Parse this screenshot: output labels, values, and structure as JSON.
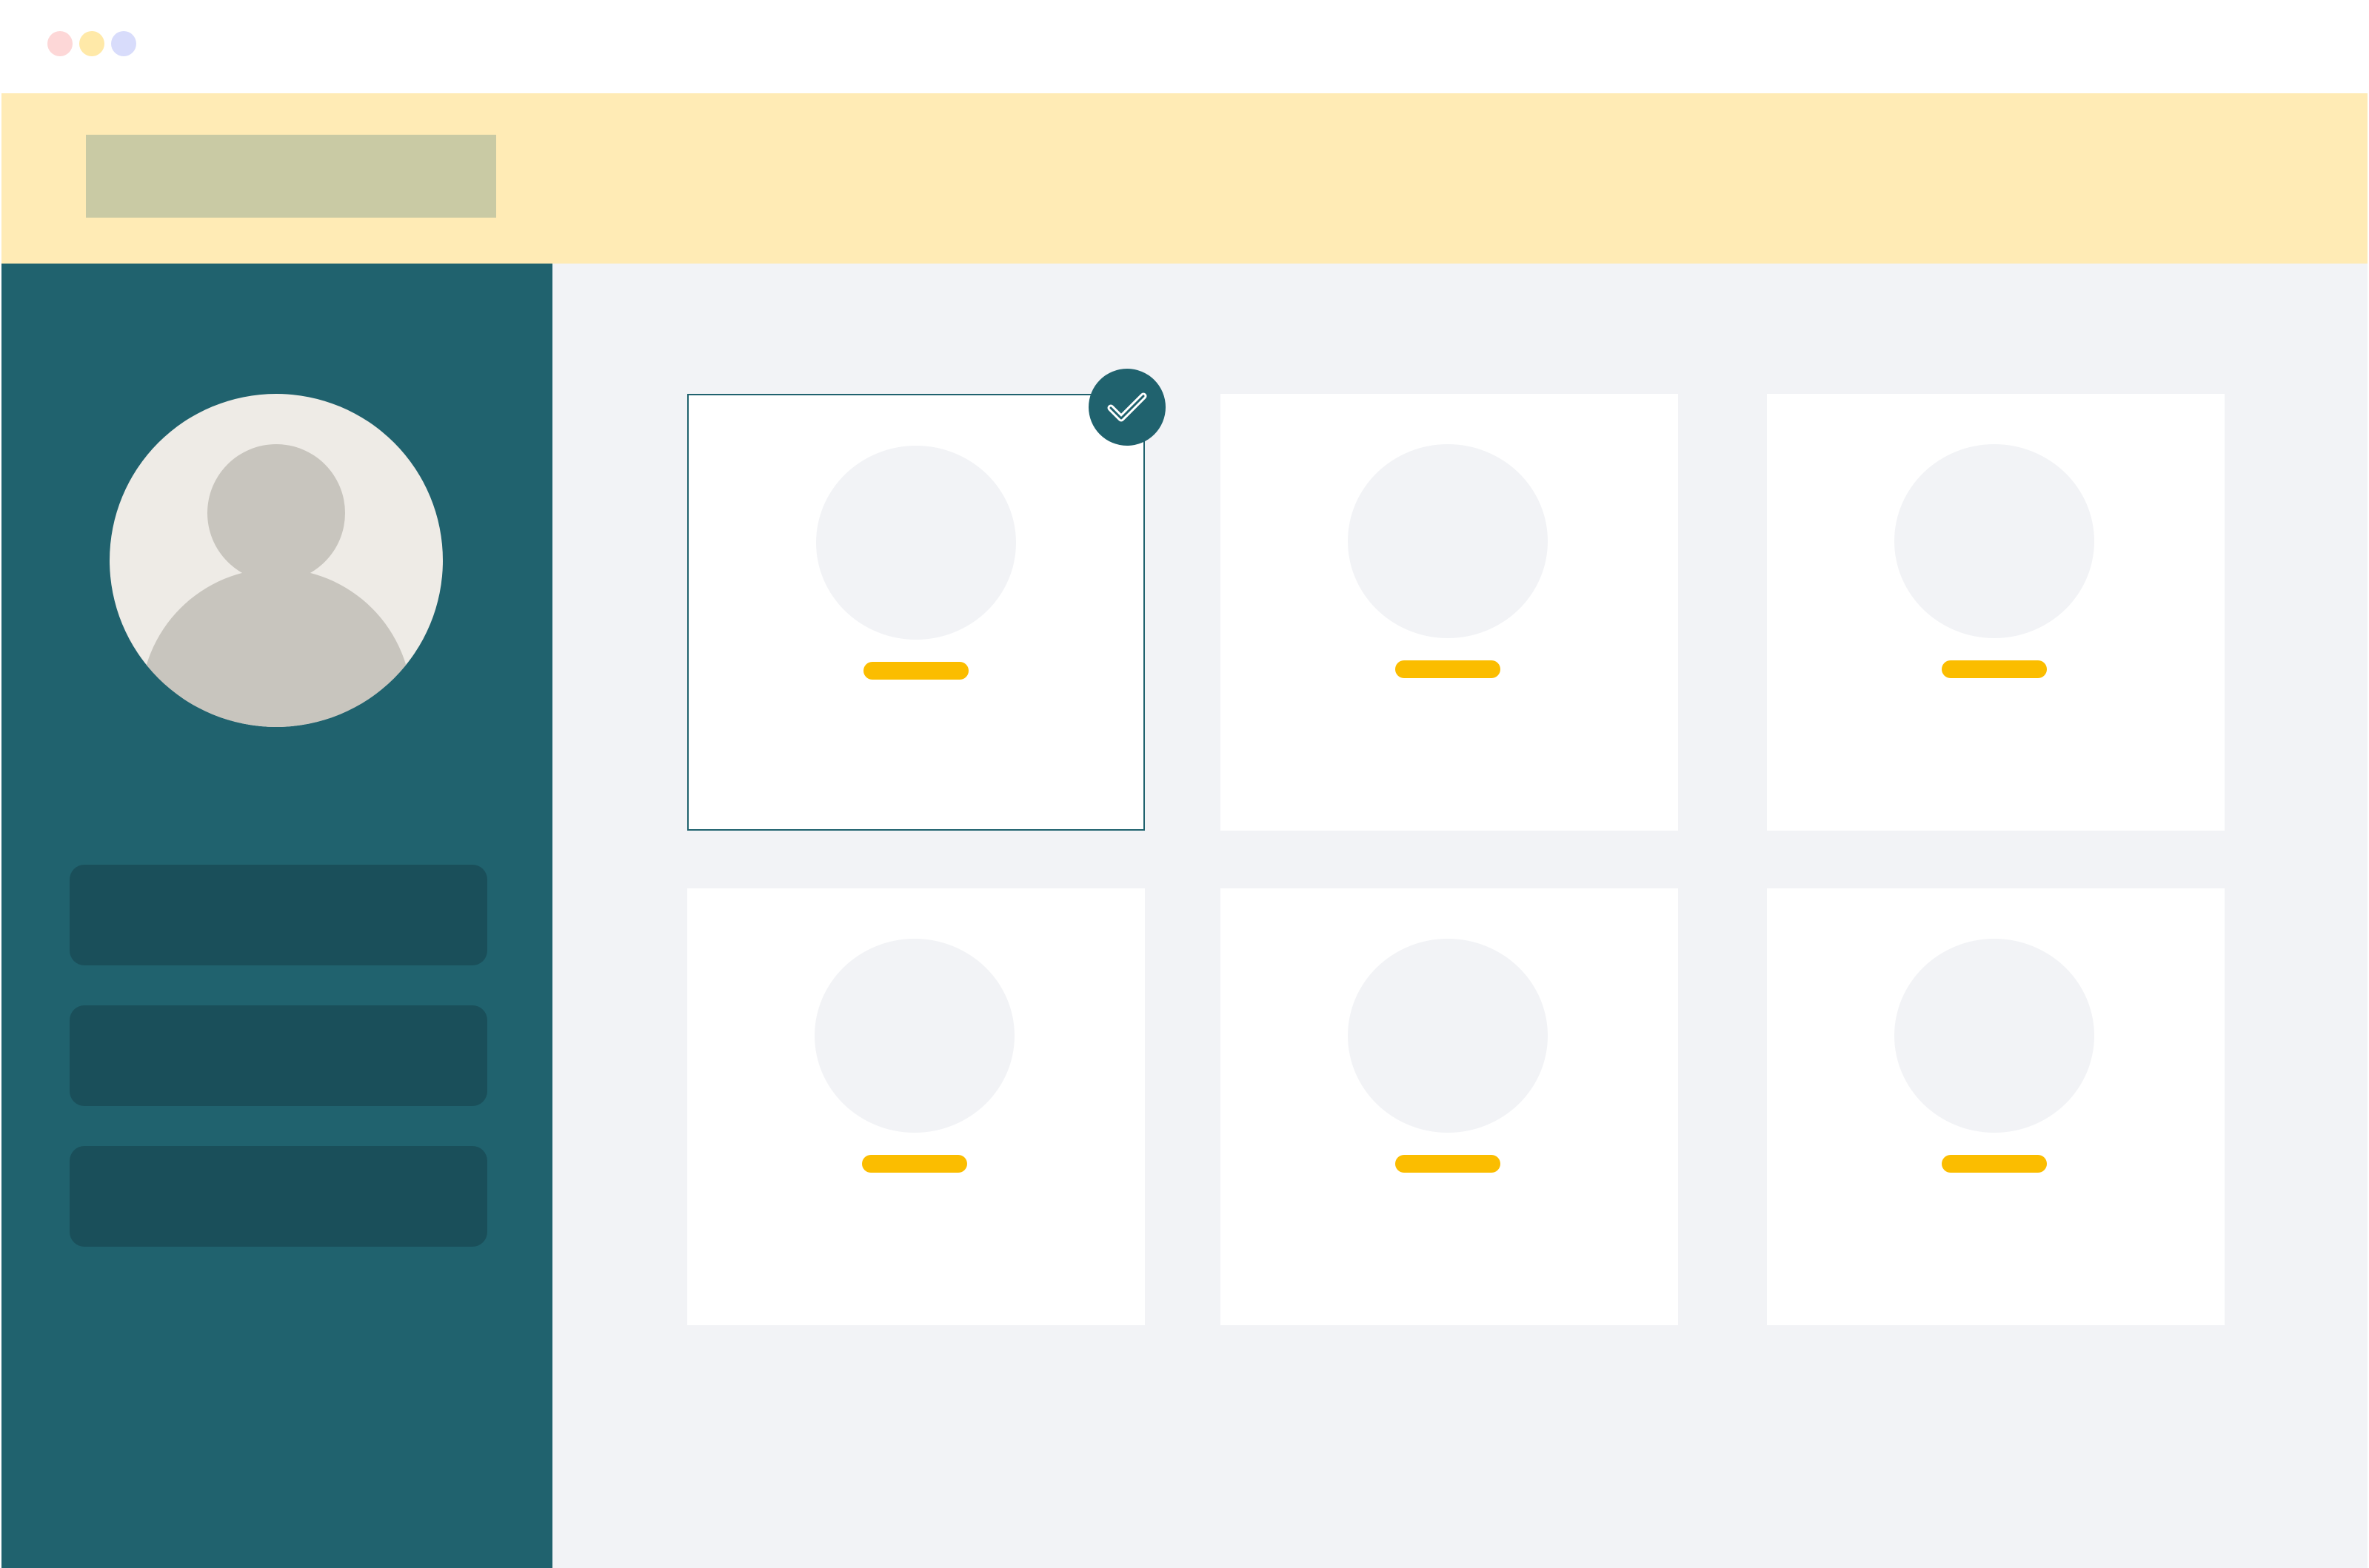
{
  "window": {
    "controls": [
      {
        "name": "close",
        "color": "#fdd7d7"
      },
      {
        "name": "minimize",
        "color": "#ffe9a8"
      },
      {
        "name": "maximize",
        "color": "#d8dcfb"
      }
    ]
  },
  "header": {
    "logo_placeholder": "",
    "background": "#ffebb5",
    "logo_color": "#c9caa4"
  },
  "sidebar": {
    "background": "#20626e",
    "avatar_icon": "user-avatar-icon",
    "nav_items": [
      {
        "label": ""
      },
      {
        "label": ""
      },
      {
        "label": ""
      }
    ]
  },
  "main": {
    "background": "#f2f3f6",
    "selected_card_index": 0,
    "check_icon": "checkmark-icon",
    "cards": [
      {
        "label": "",
        "selected": true
      },
      {
        "label": "",
        "selected": false
      },
      {
        "label": "",
        "selected": false
      },
      {
        "label": "",
        "selected": false
      },
      {
        "label": "",
        "selected": false
      },
      {
        "label": "",
        "selected": false
      }
    ],
    "accent": "#fbbd00"
  }
}
